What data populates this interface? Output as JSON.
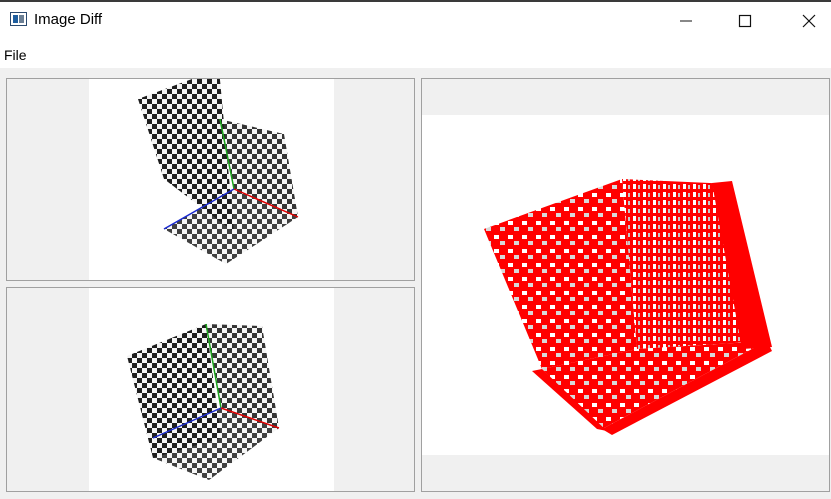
{
  "window": {
    "title": "Image Diff"
  },
  "titlebar_buttons": {
    "minimize": "minimize-icon",
    "maximize": "maximize-icon",
    "close": "close-icon"
  },
  "menu": {
    "file": "File"
  },
  "views": [
    {
      "name": "top-left-image",
      "icon": "checkerboard-render"
    },
    {
      "name": "bottom-left-image",
      "icon": "checkerboard-render"
    },
    {
      "name": "diff-image",
      "icon": "diff-render"
    }
  ],
  "colors": {
    "diff": "#ff0000",
    "background": "#f0f0f0"
  }
}
